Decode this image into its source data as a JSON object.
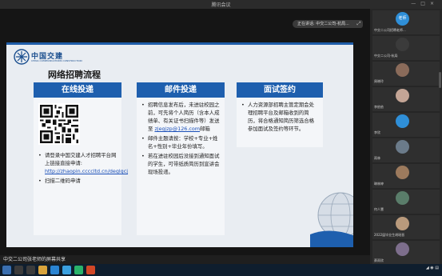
{
  "window": {
    "title": "腾讯会议"
  },
  "header": {
    "speaker_label": "正在讲话: 中交二公司-杭局..."
  },
  "slide": {
    "logo_cn": "中国交建",
    "logo_en": "CHINA COMMUNICATIONS CONSTRUCTION",
    "title": "网络招聘流程",
    "columns": [
      {
        "heading": "在线投递",
        "items": [
          {
            "text": "请登录中国交建人才招聘平台网上链接直接申请: ",
            "link": "http://zhaopin.ccccltd.cn/deglgcj"
          },
          {
            "text": "扫描二维码申请",
            "link": ""
          }
        ]
      },
      {
        "heading": "邮件投递",
        "items": [
          {
            "text": "招聘信息发布后，未进驻校园之前，可先将个人简历（含本人成绩单、有关证书扫描件等）发送至 ",
            "link": "zjegjzp@126.com",
            "after": "邮箱"
          },
          {
            "text": "邮件主题请按：学校+专业+姓名+性别+毕业年份填写。",
            "link": ""
          },
          {
            "text": "若在进驻校园后没接到通知面试的学生，可带纸质简历到宣讲会现场投递。",
            "link": ""
          }
        ]
      },
      {
        "heading": "面试签约",
        "items": [
          {
            "text": "人力资源部招聘主管定期会处理招聘平台及邮箱收到的简历，将合格通知简历筛选合格参加面试及签约等环节。",
            "link": ""
          }
        ]
      }
    ]
  },
  "share_bar": {
    "label": "中交二公司张老师的屏幕共享"
  },
  "participants": [
    {
      "avatar_text": "老师",
      "name": "中交二公司招聘老师..."
    },
    {
      "avatar_text": "",
      "name": "中交二公司-杭局"
    },
    {
      "avatar_text": "",
      "name": "周晓玲"
    },
    {
      "avatar_text": "",
      "name": "李依依"
    },
    {
      "avatar_text": "",
      "name": "李欣"
    },
    {
      "avatar_text": "",
      "name": "雨林"
    },
    {
      "avatar_text": "",
      "name": "琳林婷"
    },
    {
      "avatar_text": "",
      "name": "何人慧"
    },
    {
      "avatar_text": "",
      "name": "2022届毕业生胡瑶晋"
    },
    {
      "avatar_text": "",
      "name": "蔡雨欣"
    }
  ]
}
